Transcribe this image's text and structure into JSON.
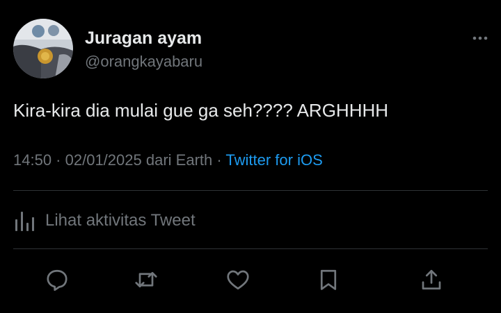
{
  "author": {
    "display_name": "Juragan ayam",
    "handle": "@orangkayabaru",
    "avatar_icon": "avatar-photo"
  },
  "tweet": {
    "text": "Kira-kira dia mulai gue ga seh???? ARGHHHH",
    "time": "14:50",
    "date": "02/01/2025",
    "location": "dari Earth",
    "source": "Twitter for iOS"
  },
  "activity": {
    "label": "Lihat aktivitas Tweet",
    "icon": "analytics-icon"
  },
  "actions": [
    {
      "name": "reply",
      "icon": "reply-icon"
    },
    {
      "name": "retweet",
      "icon": "retweet-icon"
    },
    {
      "name": "like",
      "icon": "heart-icon"
    },
    {
      "name": "bookmark",
      "icon": "bookmark-icon"
    },
    {
      "name": "share",
      "icon": "share-icon"
    }
  ],
  "menu": {
    "icon": "more-icon"
  },
  "colors": {
    "background": "#000000",
    "primary_text": "#e7e9ea",
    "secondary_text": "#71767b",
    "accent": "#1d9bf0",
    "divider": "#2f3336"
  }
}
